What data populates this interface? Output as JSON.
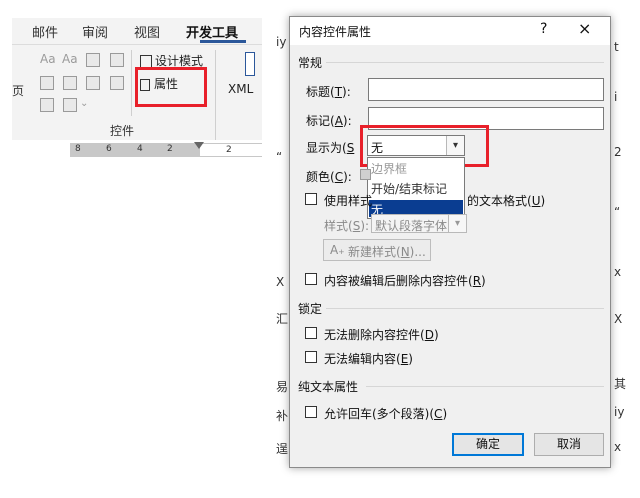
{
  "ribbon": {
    "tabs": [
      "邮件",
      "审阅",
      "视图",
      "开发工具"
    ],
    "active_tab": "开发工具",
    "cut_letter": "页",
    "font_icon_1": "Aa",
    "font_icon_2": "Aa",
    "design_mode": "设计模式",
    "properties": "属性",
    "group_label": "控件",
    "xml_label": "XML",
    "ruler_numbers": [
      "8",
      "6",
      "4",
      "2",
      "2"
    ]
  },
  "doc_marks": [
    "“",
    "X",
    "2",
    "“",
    "x",
    "X",
    "汇",
    "i",
    "易",
    "补",
    "逞",
    "iy",
    "x",
    "iy",
    "其",
    "t"
  ],
  "dialog": {
    "title": "内容控件属性",
    "help": "?",
    "close": "×",
    "general": {
      "heading": "常规",
      "title_label": "标题(",
      "title_key": "T",
      "title_suffix": "):",
      "title_value": "",
      "tag_label": "标记(",
      "tag_key": "A",
      "tag_suffix": "):",
      "tag_value": "",
      "show_as_label": "显示为(",
      "show_as_key": "S",
      "show_as_value": "无",
      "show_as_options": [
        "边界框",
        "开始/结束标记",
        "无"
      ],
      "show_as_selected": "无",
      "color_label": "颜色(",
      "color_key": "C",
      "color_suffix": "):",
      "use_style_label": "使用样式",
      "use_style_rest": "的文本格式(",
      "use_style_key": "U",
      "style_label": "样式(",
      "style_key": "S",
      "style_value": "默认段落字体",
      "new_style": "新建样式(",
      "new_style_key": "N",
      "new_style_suffix": ")...",
      "remove_when_edited": "内容被编辑后删除内容控件(",
      "remove_key": "R"
    },
    "locking": {
      "heading": "锁定",
      "cannot_delete": "无法删除内容控件(",
      "cannot_delete_key": "D",
      "cannot_edit": "无法编辑内容(",
      "cannot_edit_key": "E"
    },
    "plain_text": {
      "heading": "纯文本属性",
      "allow_returns": "允许回车(多个段落)(",
      "allow_returns_key": "C"
    },
    "ok": "确定",
    "cancel": "取消"
  },
  "colors": {
    "highlight": "#e8202a",
    "selected_item": "#0a3d91",
    "default_button_border": "#0078d7"
  }
}
